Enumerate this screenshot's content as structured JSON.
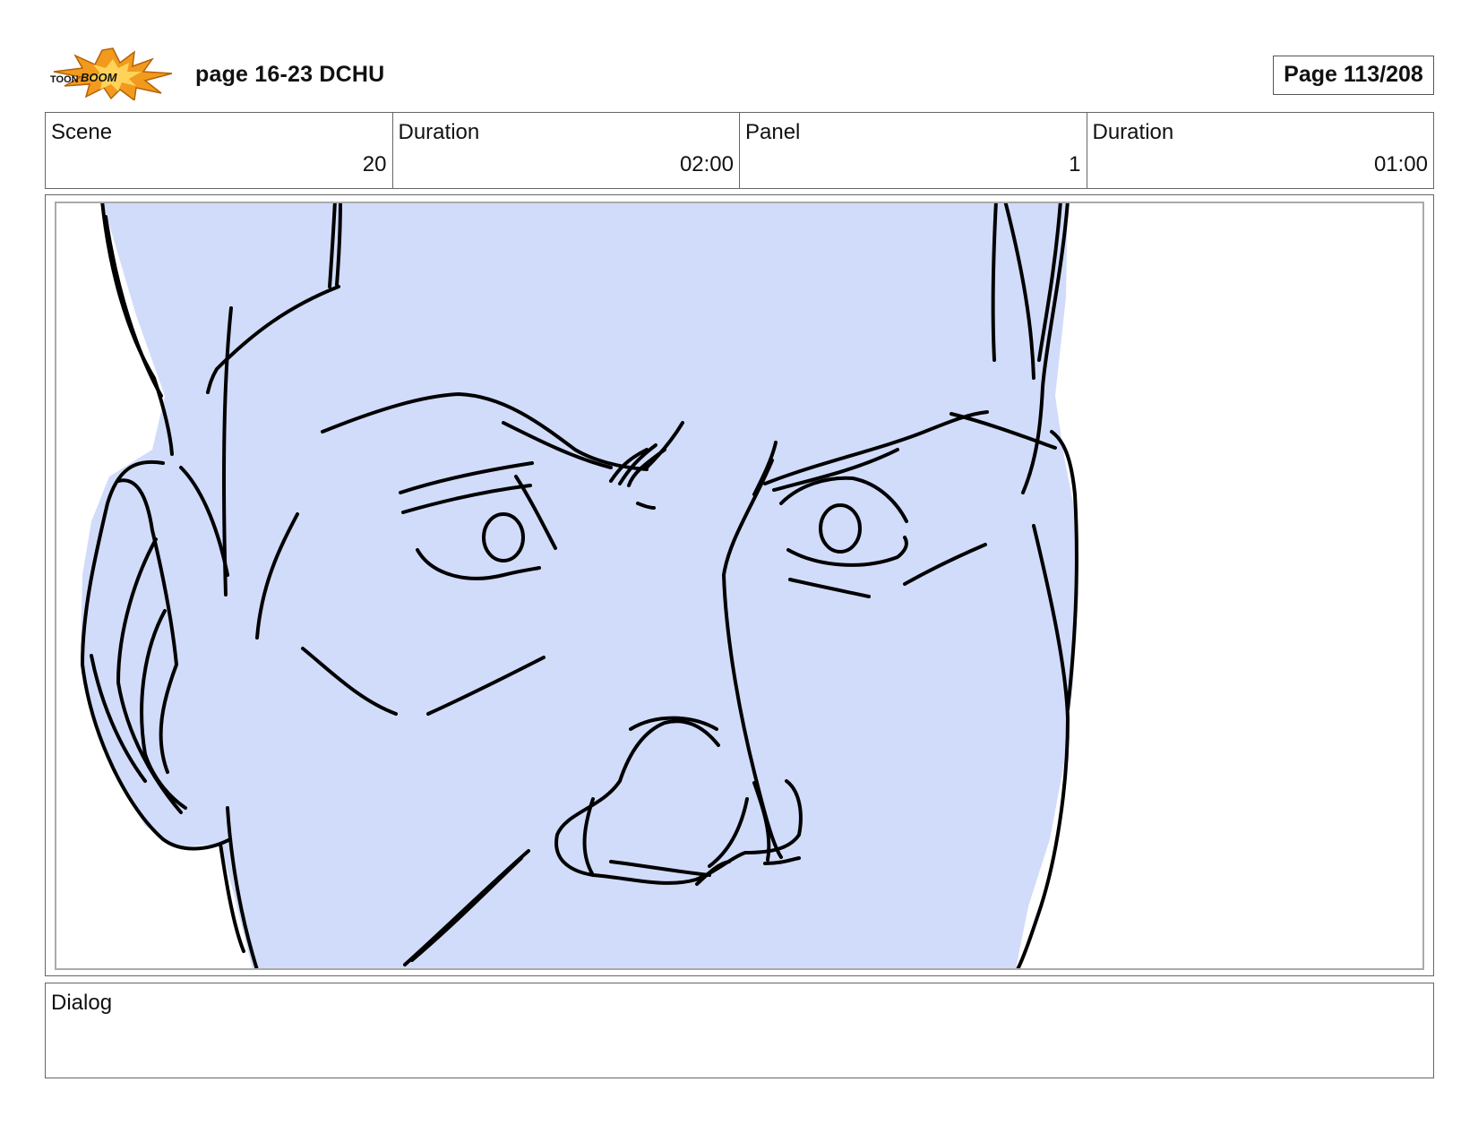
{
  "header": {
    "logo_text": "TOON BOOM",
    "project_title": "page 16-23 DCHU",
    "page_counter": "Page 113/208"
  },
  "info": {
    "scene_label": "Scene",
    "scene_value": "20",
    "scene_duration_label": "Duration",
    "scene_duration_value": "02:00",
    "panel_label": "Panel",
    "panel_value": "1",
    "panel_duration_label": "Duration",
    "panel_duration_value": "01:00"
  },
  "dialog": {
    "label": "Dialog"
  },
  "colors": {
    "face_fill": "#d1dcfa",
    "logo_burst": "#f29a1d",
    "ink": "#000000"
  }
}
